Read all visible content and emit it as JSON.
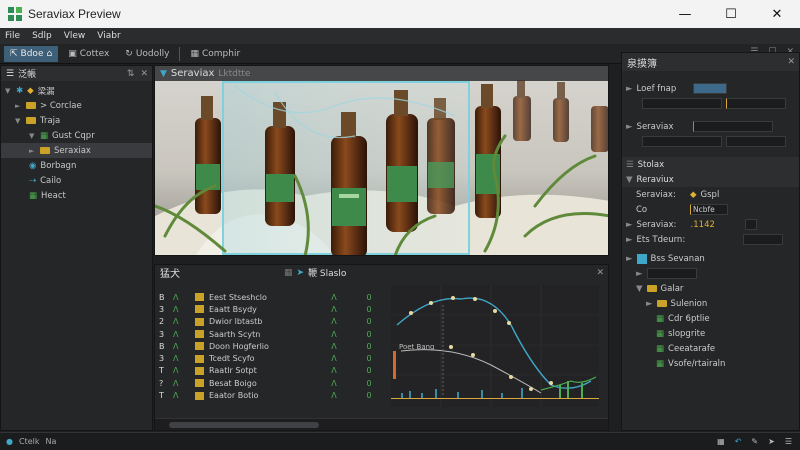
{
  "window": {
    "title": "Seraviax Preview",
    "minimize_icon": "minimize-icon",
    "maximize_icon": "maximize-icon",
    "close_icon": "close-icon"
  },
  "menu": [
    "File",
    "Sdlp",
    "Vlew",
    "Viabr"
  ],
  "toolbar": {
    "buttons": [
      {
        "label": "Bdoe",
        "active": true
      },
      {
        "label": "Cottex",
        "active": false
      },
      {
        "label": "Uodolly",
        "active": false
      },
      {
        "label": "Comphir",
        "active": false
      }
    ]
  },
  "outliner": {
    "title": "泛帳",
    "items": [
      {
        "label": "梁漏",
        "indent": 0,
        "icon": "gear-icon"
      },
      {
        "label": "> Corclae",
        "indent": 1,
        "icon": "folder-icon"
      },
      {
        "label": "Traja",
        "indent": 1,
        "icon": "folder-icon"
      },
      {
        "label": "Gust Cqpr",
        "indent": 2,
        "icon": "object-icon"
      },
      {
        "label": "Seraxiax",
        "indent": 2,
        "icon": "folder-icon",
        "selected": true
      },
      {
        "label": "Borbagn",
        "indent": 1,
        "icon": "sphere-icon"
      },
      {
        "label": "Cailo",
        "indent": 1,
        "icon": "link-icon"
      },
      {
        "label": "Heact",
        "indent": 1,
        "icon": "object-icon"
      }
    ]
  },
  "viewport": {
    "title": "Seraviax",
    "subtitle": "Lktdtte"
  },
  "timeline": {
    "title": "猛犬",
    "subtitle": "鞭 Slaslo",
    "rows": [
      {
        "n": "B",
        "a": "Λ",
        "t": "Eest Stseshclo",
        "v1": "Λ",
        "v2": "0"
      },
      {
        "n": "3",
        "a": "Λ",
        "t": "Eaatt Bsydy",
        "v1": "Λ",
        "v2": "0"
      },
      {
        "n": "2",
        "a": "Λ",
        "t": "Dwior lbtastb",
        "v1": "Λ",
        "v2": "0"
      },
      {
        "n": "3",
        "a": "Λ",
        "t": "Saarth Scytn",
        "v1": "Λ",
        "v2": "0"
      },
      {
        "n": "B",
        "a": "Λ",
        "t": "Doon Hogferlio",
        "v1": "Λ",
        "v2": "0"
      },
      {
        "n": "3",
        "a": "Λ",
        "t": "Tcedt Scyfo",
        "v1": "Λ",
        "v2": "0"
      },
      {
        "n": "T",
        "a": "Λ",
        "t": "Raatlr Sotpt",
        "v1": "Λ",
        "v2": "0"
      },
      {
        "n": "?",
        "a": "Λ",
        "t": "Besat Boigo",
        "v1": "Λ",
        "v2": "0"
      },
      {
        "n": "T",
        "a": "Λ",
        "t": "Eaator Botio",
        "v1": "Λ",
        "v2": "0"
      }
    ],
    "graph_label": "Poet Bang"
  },
  "properties": {
    "title": "泉摸簿",
    "rows": [
      {
        "type": "field",
        "label": "Loef fnap",
        "accent": true
      },
      {
        "type": "field",
        "label": "Seraviax",
        "accent": false
      },
      {
        "type": "section",
        "label": "Stolax"
      },
      {
        "type": "section",
        "label": "Reraviux"
      },
      {
        "type": "kv",
        "label": "Seraviax:",
        "value": "Gspl"
      },
      {
        "type": "kv",
        "label": "Co",
        "value": "Ncbfe"
      },
      {
        "type": "kv",
        "label": "Seraviax:",
        "value": ".1142"
      },
      {
        "type": "kv",
        "label": "Ets Tdeurn:",
        "value": ""
      },
      {
        "type": "kv",
        "label": "Bss Sevanan",
        "value": ""
      },
      {
        "type": "tree",
        "label": "Galar"
      },
      {
        "type": "tree",
        "label": "Sulenion"
      },
      {
        "type": "tree",
        "label": "Cdr 6ptlie"
      },
      {
        "type": "tree",
        "label": "slopgrite"
      },
      {
        "type": "tree",
        "label": "Ceeatarafe"
      },
      {
        "type": "tree",
        "label": "Vsofe/rtairaln"
      }
    ]
  },
  "status": {
    "left": [
      "Ctelk",
      "Na"
    ],
    "right_icons": [
      "grid-icon",
      "undo-icon",
      "chat-icon",
      "pen-icon",
      "wifi-icon"
    ]
  },
  "colors": {
    "accent": "#3d5f78",
    "selection": "#3fa7c7",
    "keyframe": "#c9a227",
    "green": "#4caf50"
  }
}
